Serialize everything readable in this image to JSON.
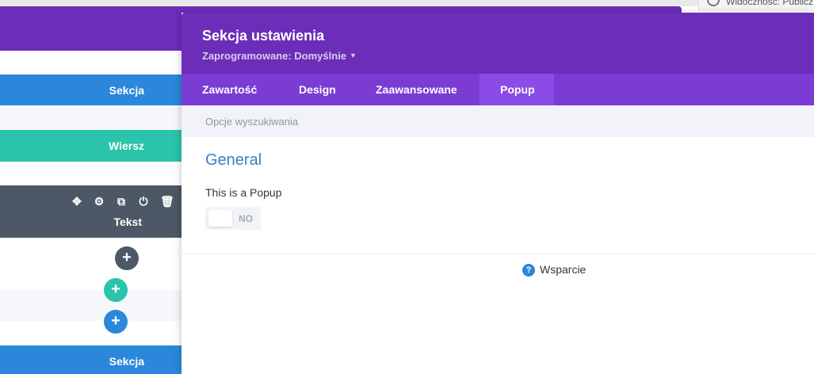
{
  "wp_admin": {
    "visibility_text": "Widoczność: Publicz"
  },
  "builder": {
    "rows": [
      {
        "label": "Sekcja",
        "color": "#2b87da"
      },
      {
        "label": "Wiersz",
        "color": "#29c4a9"
      },
      {
        "label": "Tekst",
        "color": "#4c5866"
      },
      {
        "label": "Sekcja",
        "color": "#2b87da"
      }
    ],
    "module_tools": [
      "move-icon",
      "gear-icon",
      "duplicate-icon",
      "power-icon",
      "trash-icon"
    ],
    "add_buttons": [
      {
        "symbol": "+",
        "color": "#4c5866"
      },
      {
        "symbol": "+",
        "color": "#29c4a9"
      },
      {
        "symbol": "+",
        "color": "#2b87da"
      }
    ]
  },
  "modal": {
    "title": "Sekcja ustawienia",
    "preset": "Zaprogramowane: Domyślnie",
    "tabs": [
      {
        "label": "Zawartość",
        "active": false
      },
      {
        "label": "Design",
        "active": false
      },
      {
        "label": "Zaawansowane",
        "active": false
      },
      {
        "label": "Popup",
        "active": true
      }
    ],
    "search_placeholder": "Opcje wyszukiwania",
    "section_title": "General",
    "field_label": "This is a Popup",
    "toggle_value": "NO",
    "support_label": "Wsparcie",
    "colors": {
      "header": "#6c2eb9",
      "tabs": "#7b3cd4",
      "active_tab": "#8b4be6",
      "accent": "#3d7ec9"
    }
  }
}
